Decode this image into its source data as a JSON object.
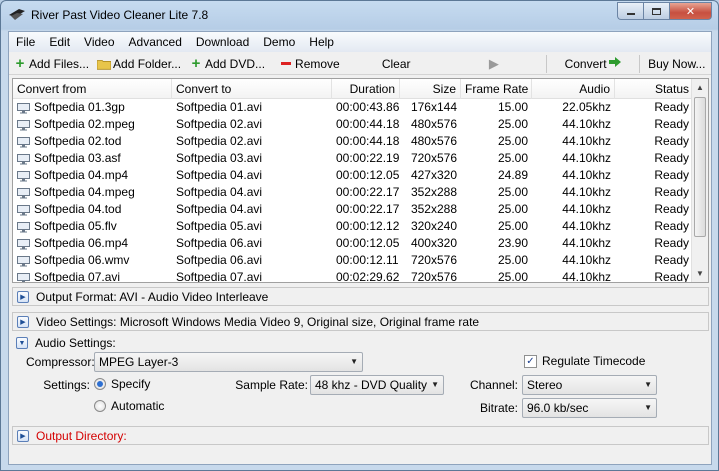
{
  "window": {
    "title": "River Past Video Cleaner Lite 7.8"
  },
  "menu": [
    "File",
    "Edit",
    "Video",
    "Advanced",
    "Download",
    "Demo",
    "Help"
  ],
  "toolbar": {
    "add_files": "Add Files...",
    "add_folder": "Add Folder...",
    "add_dvd": "Add DVD...",
    "remove": "Remove",
    "clear": "Clear",
    "convert": "Convert",
    "buy_now": "Buy Now..."
  },
  "list": {
    "columns": [
      "Convert from",
      "Convert to",
      "Duration",
      "Size",
      "Frame Rate",
      "Audio",
      "Status"
    ],
    "rows": [
      [
        "Softpedia 01.3gp",
        "Softpedia 01.avi",
        "00:00:43.86",
        "176x144",
        "15.00",
        "22.05khz",
        "Ready"
      ],
      [
        "Softpedia 02.mpeg",
        "Softpedia 02.avi",
        "00:00:44.18",
        "480x576",
        "25.00",
        "44.10khz",
        "Ready"
      ],
      [
        "Softpedia 02.tod",
        "Softpedia 02.avi",
        "00:00:44.18",
        "480x576",
        "25.00",
        "44.10khz",
        "Ready"
      ],
      [
        "Softpedia 03.asf",
        "Softpedia 03.avi",
        "00:00:22.19",
        "720x576",
        "25.00",
        "44.10khz",
        "Ready"
      ],
      [
        "Softpedia 04.mp4",
        "Softpedia 04.avi",
        "00:00:12.05",
        "427x320",
        "24.89",
        "44.10khz",
        "Ready"
      ],
      [
        "Softpedia 04.mpeg",
        "Softpedia 04.avi",
        "00:00:22.17",
        "352x288",
        "25.00",
        "44.10khz",
        "Ready"
      ],
      [
        "Softpedia 04.tod",
        "Softpedia 04.avi",
        "00:00:22.17",
        "352x288",
        "25.00",
        "44.10khz",
        "Ready"
      ],
      [
        "Softpedia 05.flv",
        "Softpedia 05.avi",
        "00:00:12.12",
        "320x240",
        "25.00",
        "44.10khz",
        "Ready"
      ],
      [
        "Softpedia 06.mp4",
        "Softpedia 06.avi",
        "00:00:12.05",
        "400x320",
        "23.90",
        "44.10khz",
        "Ready"
      ],
      [
        "Softpedia 06.wmv",
        "Softpedia 06.avi",
        "00:00:12.11",
        "720x576",
        "25.00",
        "44.10khz",
        "Ready"
      ],
      [
        "Softpedia 07.avi",
        "Softpedia 07.avi",
        "00:02:29.62",
        "720x576",
        "25.00",
        "44.10khz",
        "Ready"
      ]
    ]
  },
  "output_format": "Output Format: AVI - Audio Video Interleave",
  "video_settings": "Video Settings: Microsoft Windows Media Video 9, Original size, Original frame rate",
  "audio_settings": {
    "title": "Audio Settings:",
    "compressor_label": "Compressor:",
    "compressor_value": "MPEG Layer-3",
    "settings_label": "Settings:",
    "specify_label": "Specify",
    "automatic_label": "Automatic",
    "selected_mode": "Specify",
    "sample_rate_label": "Sample Rate:",
    "sample_rate_value": "48 khz - DVD Quality",
    "regulate_timecode_label": "Regulate Timecode",
    "regulate_timecode_checked": true,
    "channel_label": "Channel:",
    "channel_value": "Stereo",
    "bitrate_label": "Bitrate:",
    "bitrate_value": "96.0 kb/sec"
  },
  "output_directory": "Output Directory:",
  "colors": {
    "accent_green": "#2e9b2e",
    "remove_red": "#d22222",
    "output_dir_red": "#d40000"
  }
}
